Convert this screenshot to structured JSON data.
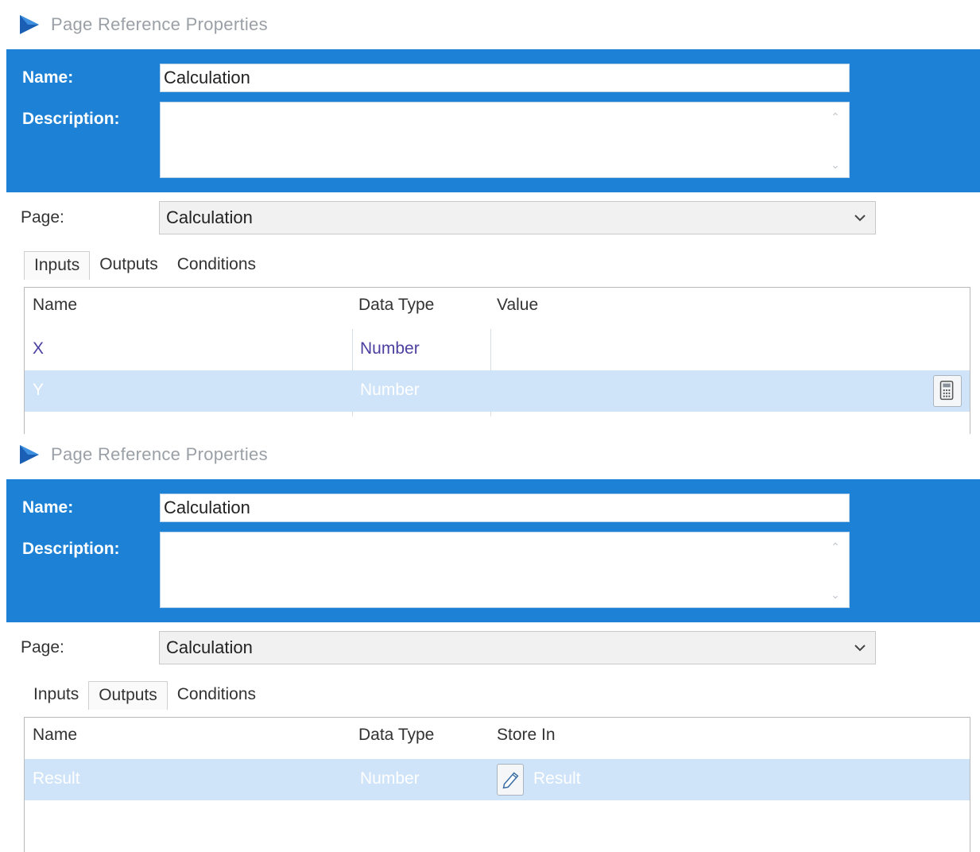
{
  "panels": [
    {
      "title": "Page Reference Properties",
      "name_label": "Name:",
      "name_value": "Calculation",
      "description_label": "Description:",
      "description_value": "",
      "page_label": "Page:",
      "page_value": "Calculation",
      "tabs": [
        "Inputs",
        "Outputs",
        "Conditions"
      ],
      "active_tab": "Inputs",
      "columns": [
        "Name",
        "Data Type",
        "Value"
      ],
      "rows": [
        {
          "name": "X",
          "data_type": "Number",
          "value": ""
        },
        {
          "name": "Y",
          "data_type": "Number",
          "value": ""
        }
      ]
    },
    {
      "title": "Page Reference Properties",
      "name_label": "Name:",
      "name_value": "Calculation",
      "description_label": "Description:",
      "description_value": "",
      "page_label": "Page:",
      "page_value": "Calculation",
      "tabs": [
        "Inputs",
        "Outputs",
        "Conditions"
      ],
      "active_tab": "Outputs",
      "columns": [
        "Name",
        "Data Type",
        "Store In"
      ],
      "rows": [
        {
          "name": "Result",
          "data_type": "Number",
          "store_in": "Result"
        }
      ]
    }
  ],
  "colors": {
    "band": "#1d82d6",
    "selected_row": "#cfe4f8",
    "type_text": "#4b3fa0"
  },
  "icons": [
    "blue-prism-logo-icon",
    "chevron-down-icon",
    "calculator-icon",
    "data-item-icon",
    "scroll-up-icon",
    "scroll-down-icon"
  ]
}
